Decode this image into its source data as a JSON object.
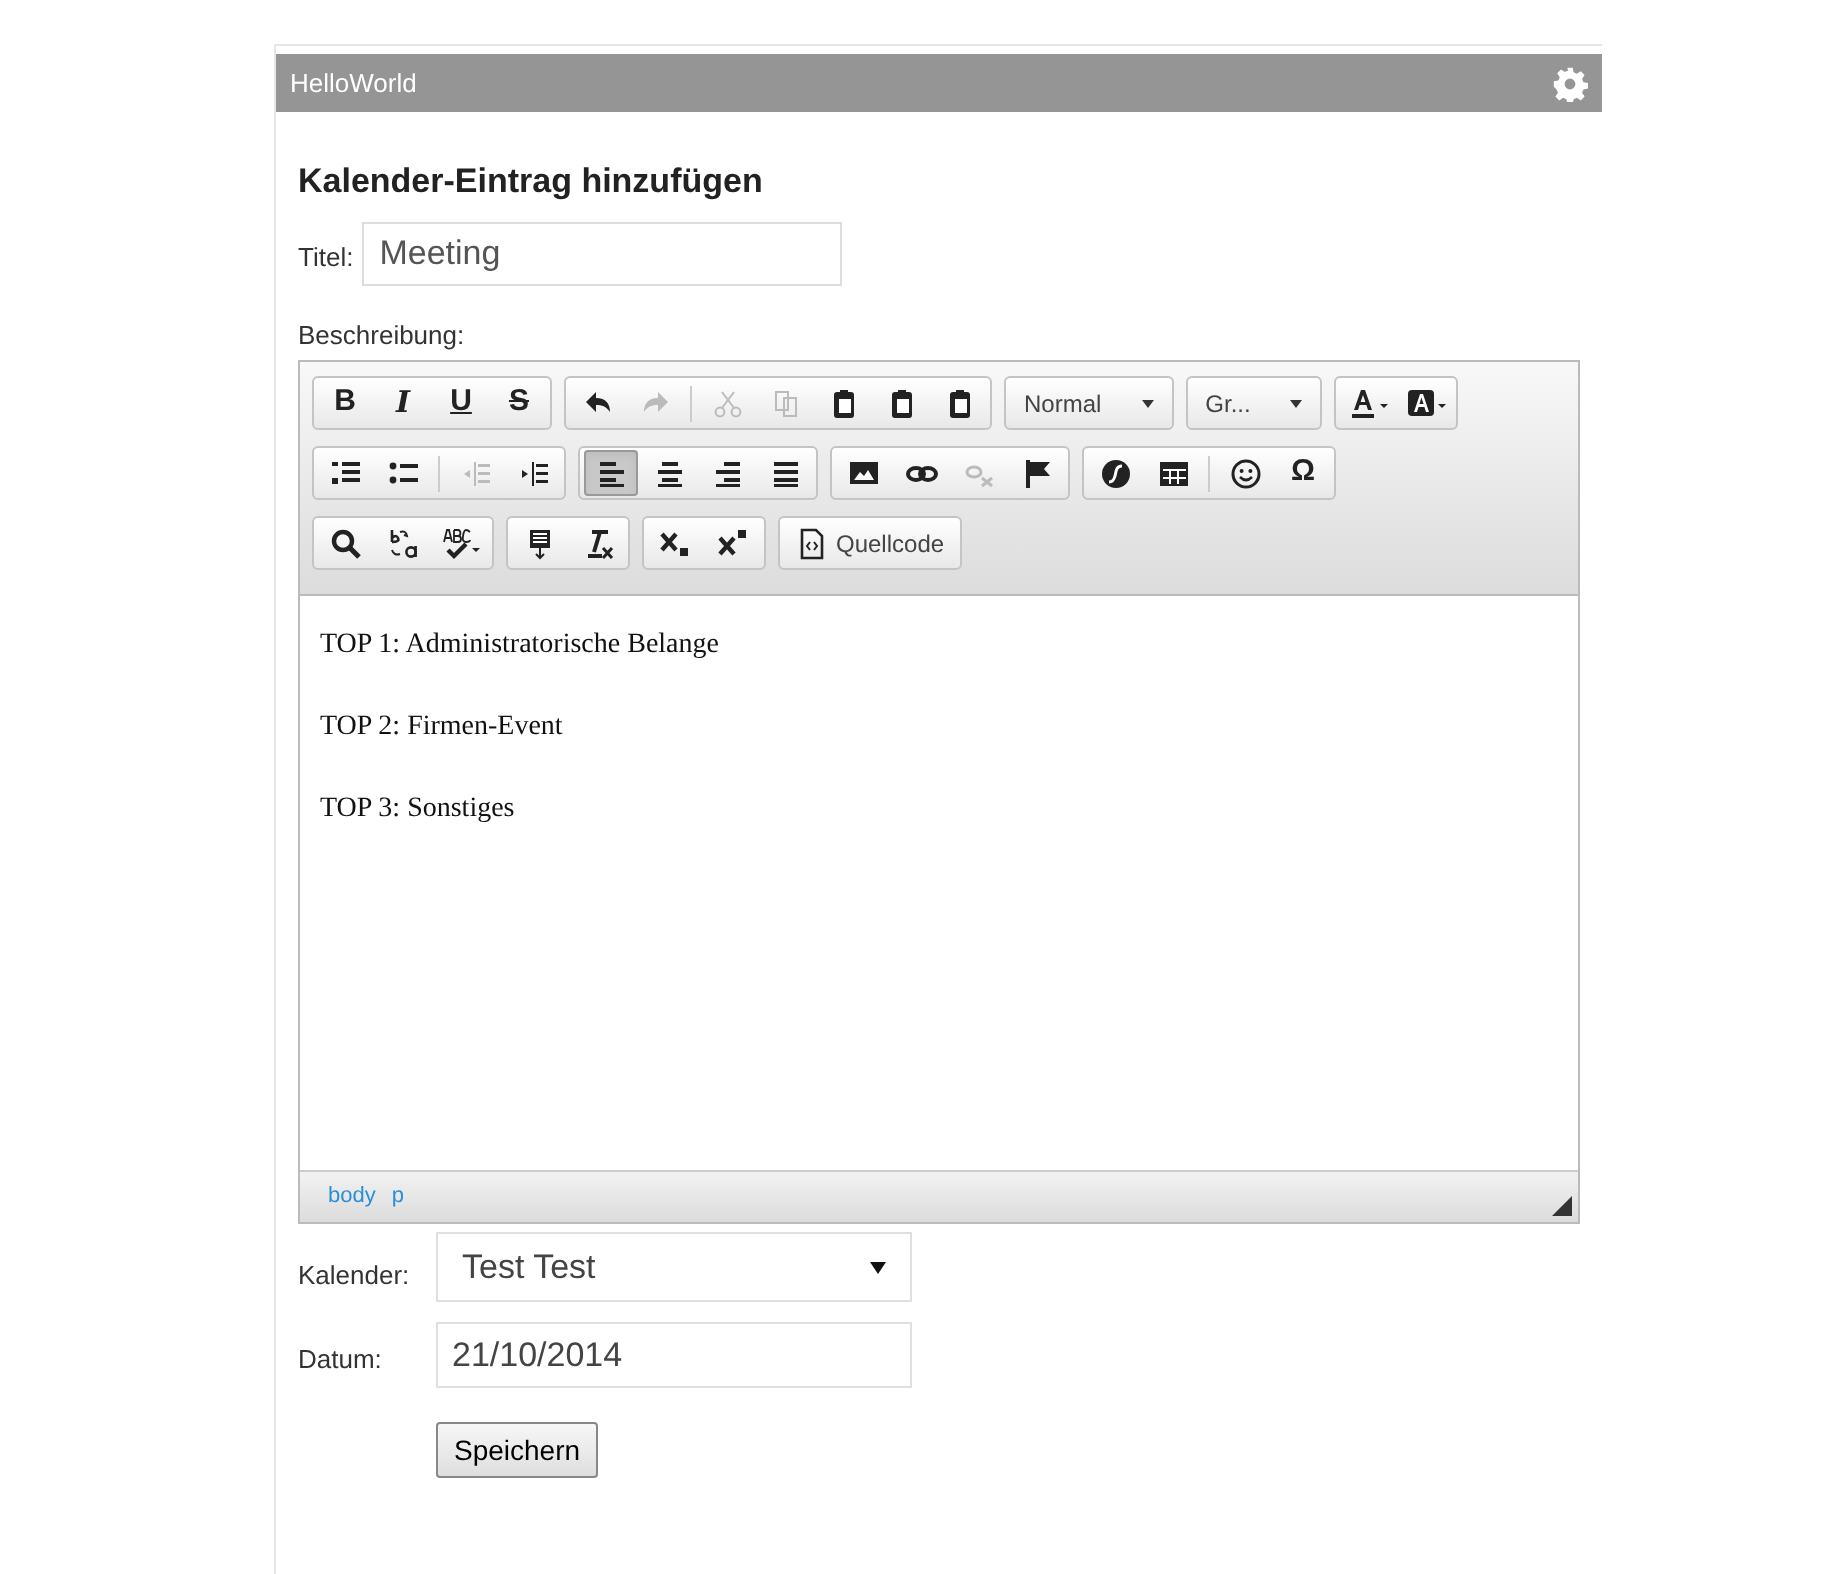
{
  "window": {
    "title": "HelloWorld"
  },
  "heading": "Kalender-Eintrag hinzufügen",
  "title_field": {
    "label": "Titel:",
    "value": "Meeting"
  },
  "description": {
    "label": "Beschreibung:",
    "toolbar": [
      {
        "groups": [
          [
            {
              "kind": "bold",
              "glyph": "B",
              "pressed": false,
              "disabled": false
            },
            {
              "kind": "italic",
              "glyph": "I",
              "pressed": false,
              "disabled": false
            },
            {
              "kind": "underline",
              "glyph": "U",
              "pressed": false,
              "disabled": false
            },
            {
              "kind": "strike",
              "glyph": "S",
              "pressed": false,
              "disabled": false
            }
          ],
          [
            {
              "kind": "undo",
              "pressed": false,
              "disabled": false
            },
            {
              "kind": "redo",
              "pressed": false,
              "disabled": true
            },
            {
              "kind": "sep"
            },
            {
              "kind": "cut",
              "pressed": false,
              "disabled": true
            },
            {
              "kind": "copy",
              "pressed": false,
              "disabled": true
            },
            {
              "kind": "paste",
              "pressed": false,
              "disabled": false
            },
            {
              "kind": "paste",
              "pressed": false,
              "disabled": false
            },
            {
              "kind": "paste",
              "pressed": false,
              "disabled": false
            }
          ],
          [
            {
              "kind": "dropdown",
              "label": "Normal"
            },
            {
              "kind": "dropdown",
              "label": "Gr..."
            }
          ],
          [
            {
              "kind": "textcolor",
              "pressed": false,
              "disabled": false
            },
            {
              "kind": "bgcolor",
              "pressed": false,
              "disabled": false
            }
          ]
        ]
      },
      {
        "groups": [
          [
            {
              "kind": "numlist",
              "pressed": false,
              "disabled": false
            },
            {
              "kind": "bullist",
              "pressed": false,
              "disabled": false
            },
            {
              "kind": "sep"
            },
            {
              "kind": "outdent",
              "pressed": false,
              "disabled": true
            },
            {
              "kind": "indent",
              "pressed": false,
              "disabled": false
            }
          ],
          [
            {
              "kind": "alignleft",
              "pressed": true,
              "disabled": false
            },
            {
              "kind": "aligncenter",
              "pressed": false,
              "disabled": false
            },
            {
              "kind": "alignright",
              "pressed": false,
              "disabled": false
            },
            {
              "kind": "justify",
              "pressed": false,
              "disabled": false
            }
          ],
          [
            {
              "kind": "image",
              "pressed": false,
              "disabled": false
            },
            {
              "kind": "link",
              "pressed": false,
              "disabled": false
            },
            {
              "kind": "unlink",
              "pressed": false,
              "disabled": true
            },
            {
              "kind": "flag",
              "pressed": false,
              "disabled": false
            }
          ],
          [
            {
              "kind": "flash",
              "pressed": false,
              "disabled": false
            },
            {
              "kind": "table",
              "pressed": false,
              "disabled": false
            },
            {
              "kind": "sep"
            },
            {
              "kind": "smiley",
              "pressed": false,
              "disabled": false
            },
            {
              "kind": "omega",
              "glyph": "Ω",
              "pressed": false,
              "disabled": false
            }
          ]
        ]
      },
      {
        "groups": [
          [
            {
              "kind": "search",
              "pressed": false,
              "disabled": false
            },
            {
              "kind": "replace",
              "pressed": false,
              "disabled": false
            },
            {
              "kind": "spell",
              "pressed": false,
              "disabled": false
            }
          ],
          [
            {
              "kind": "block",
              "pressed": false,
              "disabled": false
            },
            {
              "kind": "clearformat",
              "pressed": false,
              "disabled": false
            }
          ],
          [
            {
              "kind": "subscript",
              "pressed": false,
              "disabled": false
            },
            {
              "kind": "superscript",
              "pressed": false,
              "disabled": false
            }
          ],
          [
            {
              "kind": "source",
              "label": "Quellcode",
              "pressed": false,
              "disabled": false
            }
          ]
        ]
      }
    ],
    "paragraphs": [
      "TOP 1: Administratorische Belange",
      "TOP 2: Firmen-Event",
      "TOP 3: Sonstiges"
    ],
    "path": [
      "body",
      "p"
    ]
  },
  "calendar_field": {
    "label": "Kalender:",
    "value": "Test Test"
  },
  "date_field": {
    "label": "Datum:",
    "value": "21/10/2014"
  },
  "save_button": "Speichern"
}
